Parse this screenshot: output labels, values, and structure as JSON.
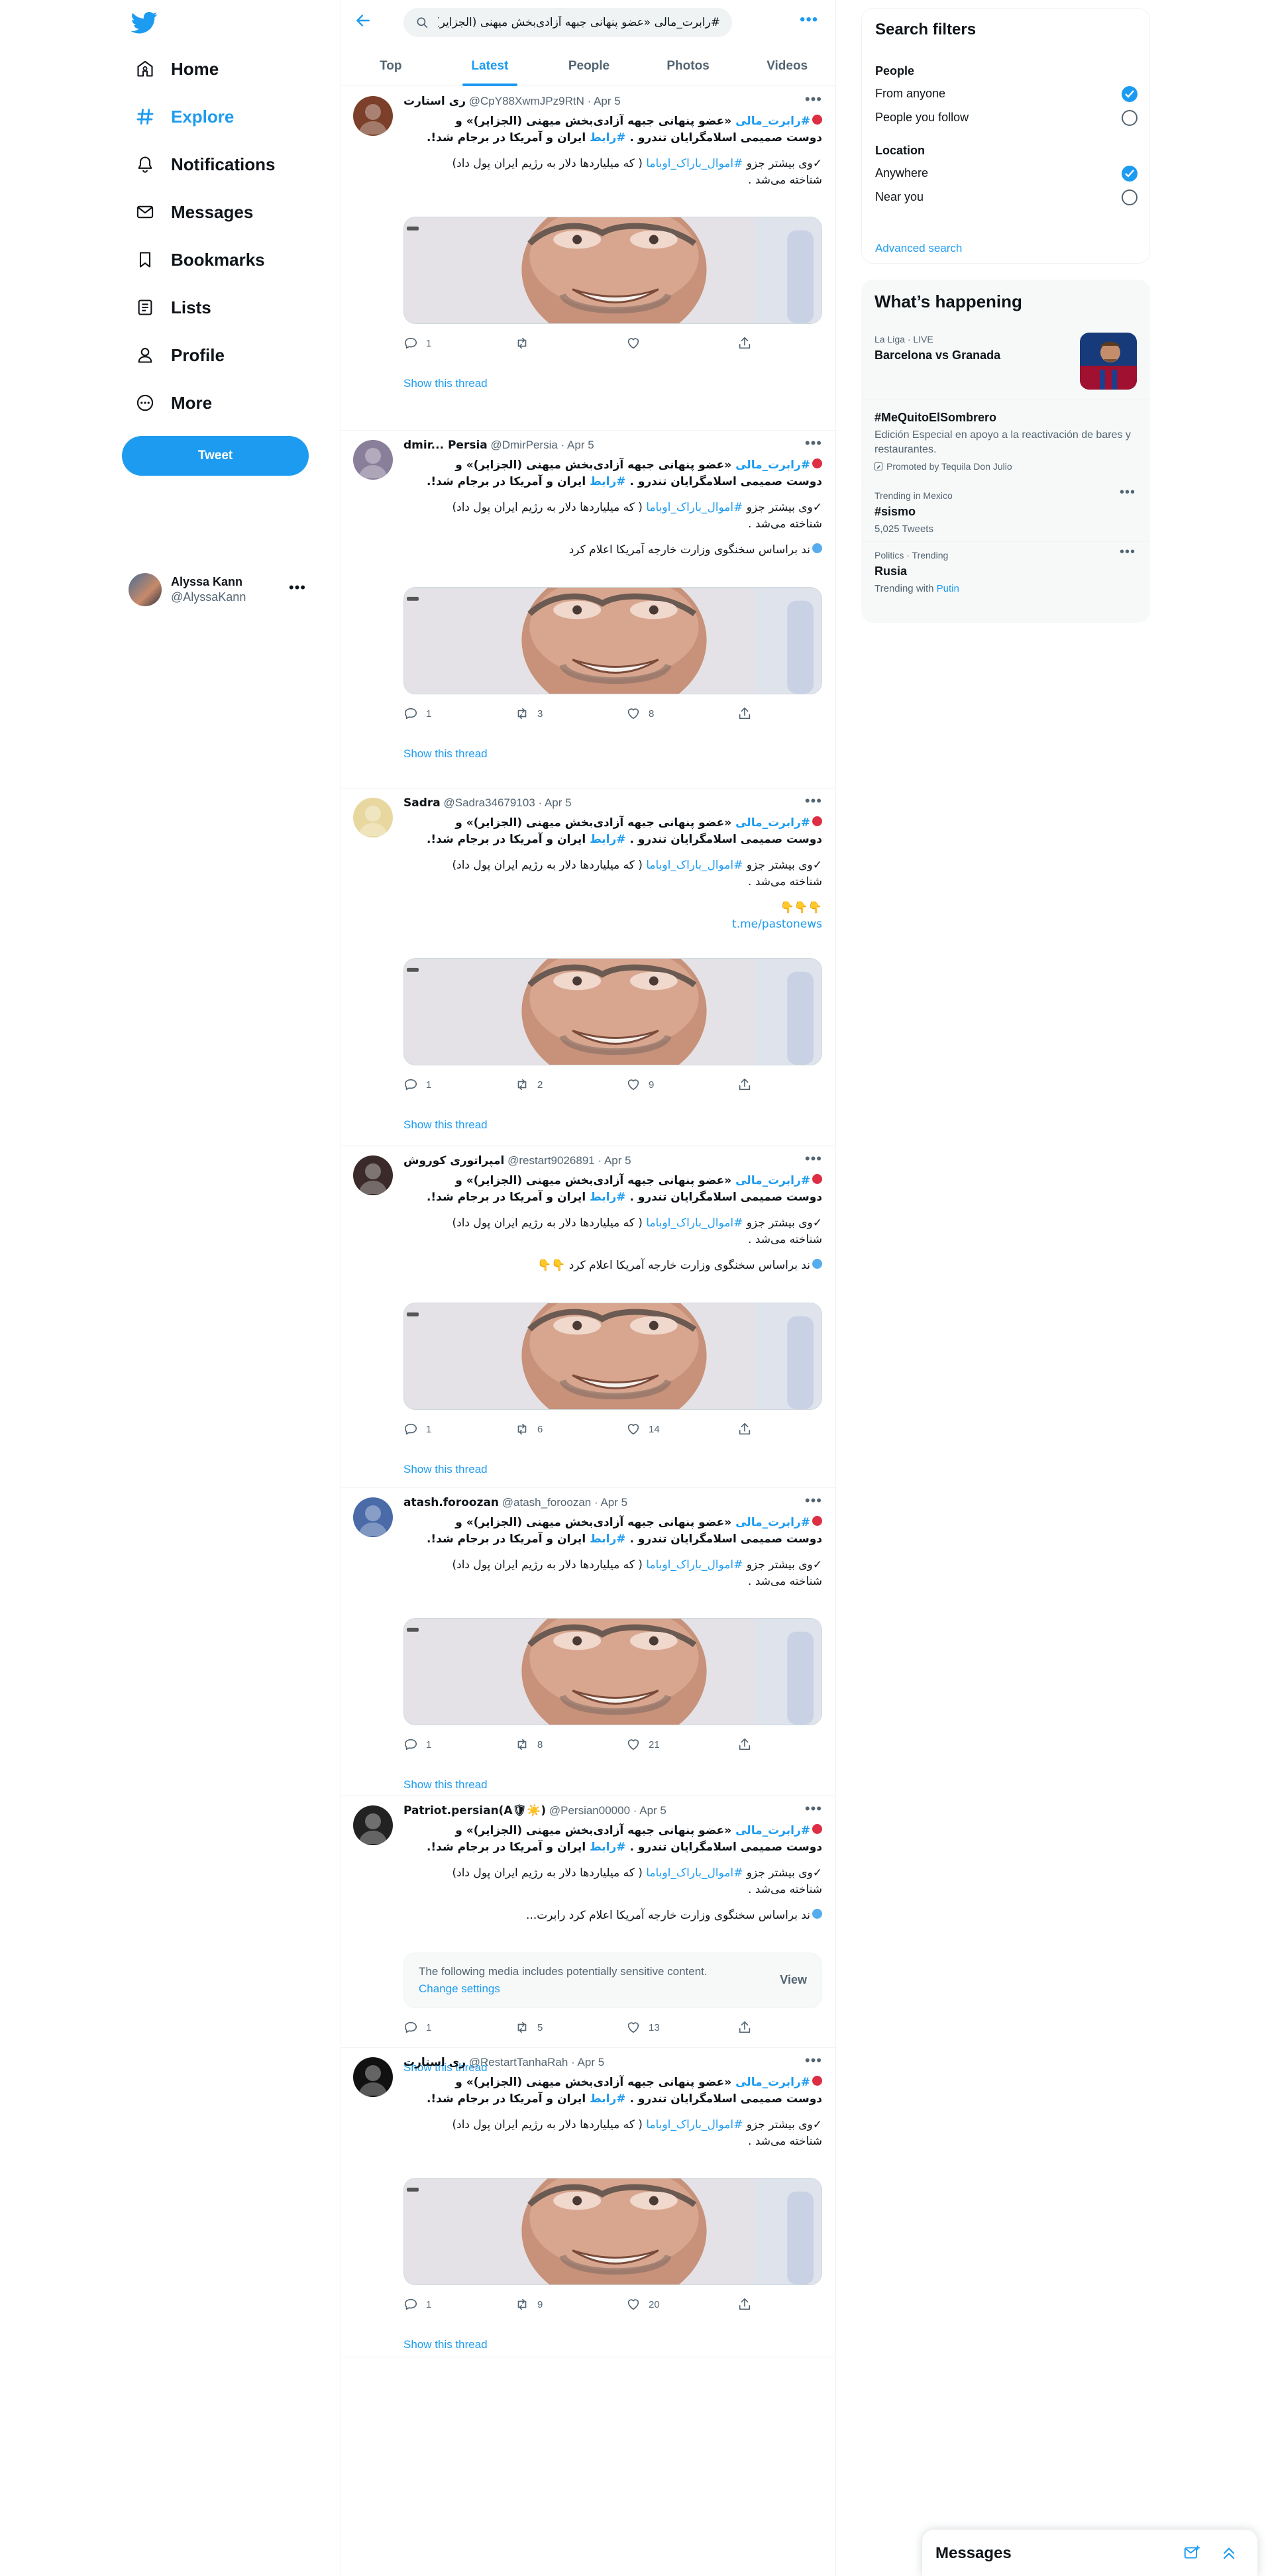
{
  "nav": {
    "items": [
      {
        "label": "Home",
        "icon": "home-icon"
      },
      {
        "label": "Explore",
        "icon": "hashtag-icon"
      },
      {
        "label": "Notifications",
        "icon": "bell-icon"
      },
      {
        "label": "Messages",
        "icon": "envelope-icon"
      },
      {
        "label": "Bookmarks",
        "icon": "bookmark-icon"
      },
      {
        "label": "Lists",
        "icon": "list-icon"
      },
      {
        "label": "Profile",
        "icon": "person-icon"
      },
      {
        "label": "More",
        "icon": "more-circle-icon"
      }
    ],
    "active": "Explore",
    "tweet_label": "Tweet",
    "account": {
      "name": "Alyssa Kann",
      "handle": "@AlyssaKann"
    }
  },
  "search": {
    "query": "#رابرت_مالی «عضو پنهانی جبهه آزادی‌بخش میهنی (الجزایر)» و"
  },
  "tabs": [
    "Top",
    "Latest",
    "People",
    "Photos",
    "Videos"
  ],
  "active_tab": "Latest",
  "tweet_text": {
    "line1_tag": "#رابرت_مالی",
    "line1_rest": "«عضو پنهانی جبهه آزادی‌بخش میهنی (الجزایر)» و",
    "line2": "دوست صمیمی اسلامگرایان تندرو .",
    "line2_tag": "#رابط",
    "line2_rest": "ایران و آمریکا در برجام شد!.",
    "p2_a": "✓وی بیشتر جزو",
    "p2_tag": "#اموال_باراک_اوباما",
    "p2_b": "( که میلیاردها دلار به رژیم ایران پول داد)",
    "p2_c": "شناخته می‌شد .",
    "extra_full": "ند براساس سخنگوی وزارت خارجه آمریکا اعلام کرد",
    "extra_trunc": "ند براساس سخنگوی وزارت خارجه آمریکا اعلام کرد رابرت...",
    "extra_emoji": "ند براساس سخنگوی وزارت خارجه آمریکا اعلام کرد 👇👇",
    "hands": "👇👇👇",
    "link": "t.me/pastonews"
  },
  "tweets": [
    {
      "name": "ری استارت",
      "handle": "@CpY88XwmJPz9RtN",
      "date": "Apr 5",
      "variant": "basic",
      "replies": "1",
      "retweets": "",
      "likes": "",
      "show_thread": "Show this thread",
      "avatar": "#7b3f2a"
    },
    {
      "name": "dmir... Persia",
      "handle": "@DmirPersia",
      "date": "Apr 5",
      "variant": "extra",
      "replies": "1",
      "retweets": "3",
      "likes": "8",
      "show_thread": "Show this thread",
      "avatar": "#8a7f9a"
    },
    {
      "name": "Sadra",
      "handle": "@Sadra34679103",
      "date": "Apr 5",
      "variant": "link",
      "replies": "1",
      "retweets": "2",
      "likes": "9",
      "show_thread": "Show this thread",
      "avatar": "#e8d8a0"
    },
    {
      "name": "امپراتوری کوروش",
      "handle": "@restart9026891",
      "date": "Apr 5",
      "variant": "emoji",
      "replies": "1",
      "retweets": "6",
      "likes": "14",
      "show_thread": "Show this thread",
      "avatar": "#3a2a2a"
    },
    {
      "name": "atash.foroozan",
      "handle": "@atash_foroozan",
      "date": "Apr 5",
      "variant": "basic",
      "replies": "1",
      "retweets": "8",
      "likes": "21",
      "show_thread": "Show this thread",
      "avatar": "#4a6aa8"
    },
    {
      "name": "Patriot.persian(A🛡☀️)",
      "handle": "@Persian00000",
      "date": "Apr 5",
      "variant": "sensitive",
      "replies": "1",
      "retweets": "5",
      "likes": "13",
      "show_thread": "Show this thread",
      "avatar": "#222222"
    },
    {
      "name": "ری استارت",
      "handle": "@RestartTanhaRah",
      "date": "Apr 5",
      "variant": "basic",
      "replies": "1",
      "retweets": "9",
      "likes": "20",
      "show_thread": "Show this thread",
      "avatar": "#111111"
    }
  ],
  "sensitive": {
    "text": "The following media includes potentially sensitive content.",
    "link": "Change settings",
    "view": "View"
  },
  "filters": {
    "title": "Search filters",
    "people_label": "People",
    "people_opts": [
      "From anyone",
      "People you follow"
    ],
    "location_label": "Location",
    "location_opts": [
      "Anywhere",
      "Near you"
    ],
    "advanced": "Advanced search"
  },
  "trends": {
    "title": "What’s happening",
    "items": [
      {
        "cat": "La Liga · LIVE",
        "title": "Barcelona vs Granada"
      },
      {
        "title": "#MeQuitoElSombrero",
        "desc": "Edición Especial en apoyo a la reactivación de bares y restaurantes.",
        "promo": "Promoted by Tequila Don Julio"
      },
      {
        "cat": "Trending in Mexico",
        "title": "#sismo",
        "sub": "5,025 Tweets"
      },
      {
        "cat": "Politics · Trending",
        "title": "Rusia",
        "sub_prefix": "Trending with",
        "sub_link": "Putin"
      }
    ]
  },
  "messages_bar": {
    "title": "Messages"
  },
  "colors": {
    "accent": "#1d9bf0",
    "text": "#0f1419",
    "muted": "#536471"
  }
}
